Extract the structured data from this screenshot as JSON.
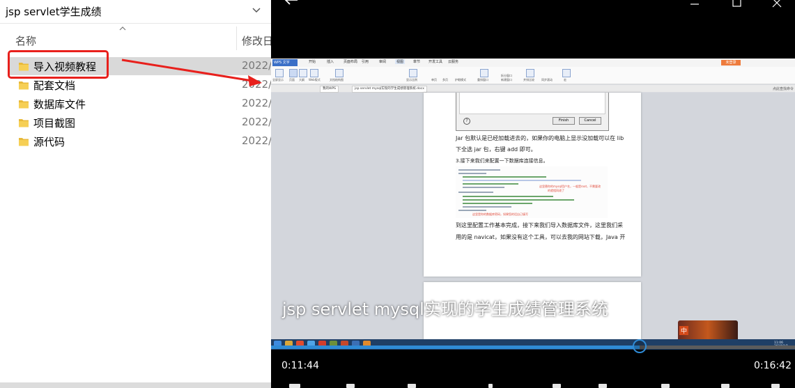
{
  "explorer": {
    "title": "jsp servlet学生成绩",
    "columns": {
      "name": "名称",
      "date": "修改日"
    },
    "files": [
      {
        "name": "导入视频教程",
        "date": "2022/",
        "selected": true
      },
      {
        "name": "配套文档",
        "date": "2022/"
      },
      {
        "name": "数据库文件",
        "date": "2022/"
      },
      {
        "name": "项目截图",
        "date": "2022/"
      },
      {
        "name": "源代码",
        "date": "2022/"
      }
    ]
  },
  "player": {
    "subtitle": "jsp servlet mysql实现的学生成绩管理系统",
    "time_current": "0:11:44",
    "time_total": "0:16:42",
    "progress": 0.703
  },
  "screen": {
    "app_logo": "WPS 文字",
    "tabs": [
      "开始",
      "插入",
      "页面布局",
      "引用",
      "审阅",
      "视图",
      "章节",
      "开发工具",
      "云服务"
    ],
    "login": "未登录",
    "ribbon_labels": [
      "全屏显示",
      "页面",
      "大纲",
      "Web版式",
      "文档结构图",
      "显示比例",
      "单页",
      "多页",
      "护眼模式",
      "重排窗口",
      "新建窗口",
      "拆分窗口",
      "并排比较",
      "同步滚动",
      "宏"
    ],
    "doc_tabs": [
      "我的WPS",
      "jsp servlet mysql实现的学生成绩管理系统.docx"
    ],
    "search": "点此查找命令",
    "dialog": {
      "help": "?",
      "finish": "Finish",
      "cancel": "Cancel"
    },
    "doc_lines": [
      "Jar 包默认是已经加载进去的，如果你的电脑上显示没加载可以在 lib",
      "下全选 jar 包，右键 add 即可。",
      "3.接下来我们来配置一下数据库连接信息。",
      "到这里配置工作基本完成，接下来我们导入数据库文件，这里我们采",
      "用的是 navicat，如果没有这个工具，可以去我的网站下载，Java 开"
    ],
    "code_notes": [
      "这里替你的mysql用户名，一般是root，不需要改",
      "的就相同改了",
      "这里是你的数据库密码，如果您的话自己填写"
    ],
    "ime": "中",
    "tray_time": "11:06\n2018/1/1"
  },
  "colors": {
    "accent": "#2f8bd6",
    "highlight": "#e8201c",
    "selected_row": "#d9d9d9"
  },
  "icons": [
    "folder-icon",
    "chevron-down-icon",
    "sort-up-icon",
    "back-arrow-icon",
    "minimize-icon",
    "maximize-icon",
    "close-icon"
  ]
}
